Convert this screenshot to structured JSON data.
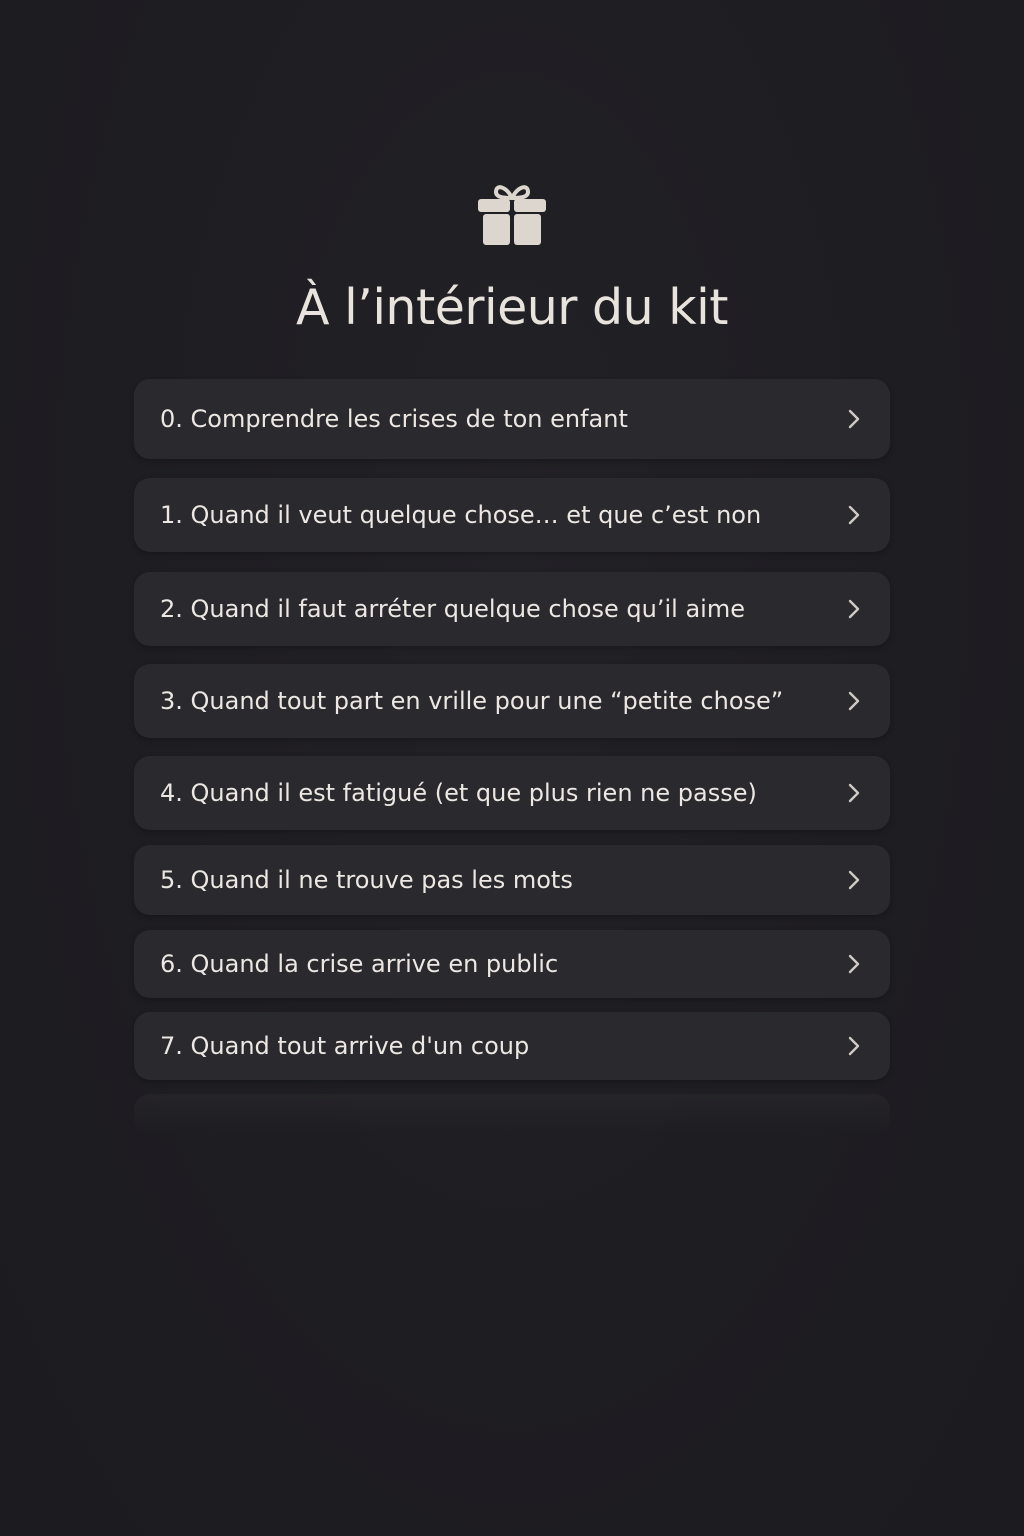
{
  "header": {
    "icon": "gift-icon",
    "title": "À l’intérieur du kit"
  },
  "colors": {
    "background": "#1e1d22",
    "card": "#2a292e",
    "text": "#ece7e2",
    "chevron": "#cfcac6"
  },
  "items": [
    {
      "label": "0. Comprendre les crises de ton enfant",
      "icon": "chevron-right-icon"
    },
    {
      "label": "1.  Quand il veut quelque chose… et que c’est non",
      "icon": "chevron-right-icon"
    },
    {
      "label": "2. Quand il faut arréter quelque chose qu’il aime",
      "icon": "chevron-right-icon"
    },
    {
      "label": "3. Quand tout part en vrille pour une “petite chose”",
      "icon": "chevron-right-icon"
    },
    {
      "label": "4. Quand il est fatigué (et que plus rien ne passe)",
      "icon": "chevron-right-icon"
    },
    {
      "label": "5. Quand il ne trouve pas les mots",
      "icon": "chevron-right-icon"
    },
    {
      "label": "6. Quand la crise arrive en public",
      "icon": "chevron-right-icon"
    },
    {
      "label": "7. Quand tout arrive d'un coup",
      "icon": "chevron-right-icon"
    }
  ]
}
